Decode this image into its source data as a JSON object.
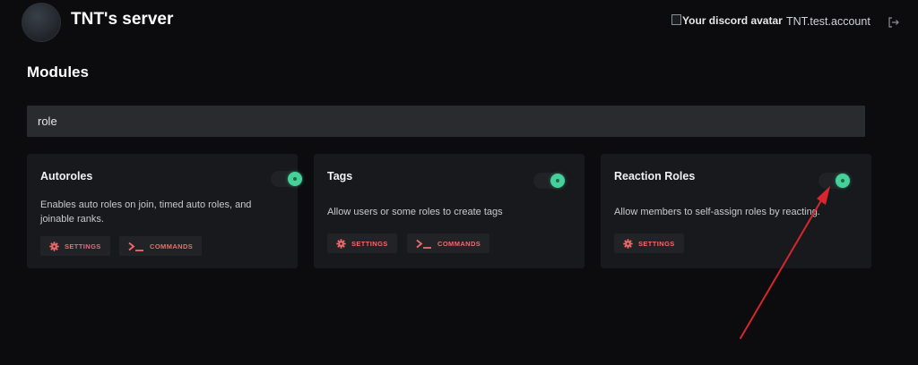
{
  "header": {
    "server_name": "TNT's server",
    "user_avatar_alt": "Your discord avatar",
    "user_name": "TNT.test.account"
  },
  "page_title": "Modules",
  "search": {
    "value": "role"
  },
  "modules": [
    {
      "title": "Autoroles",
      "description": "Enables auto roles on join, timed auto roles, and joinable ranks.",
      "enabled": true,
      "buttons": {
        "settings": "SETTINGS",
        "commands": "COMMANDS"
      }
    },
    {
      "title": "Tags",
      "description": "Allow users or some roles to create tags",
      "enabled": true,
      "buttons": {
        "settings": "SETTINGS",
        "commands": "COMMANDS"
      }
    },
    {
      "title": "Reaction Roles",
      "description": "Allow members to self-assign roles by reacting.",
      "enabled": true,
      "buttons": {
        "settings": "SETTINGS"
      }
    }
  ],
  "icons": {
    "settings": "gear-icon",
    "commands": "terminal-icon",
    "logout": "logout-icon"
  },
  "colors": {
    "background": "#0c0c0f",
    "card": "#18191c",
    "toggle_on": "#45d29a",
    "button_text": "#f06a6a",
    "annotation_arrow": "#d8262e"
  }
}
